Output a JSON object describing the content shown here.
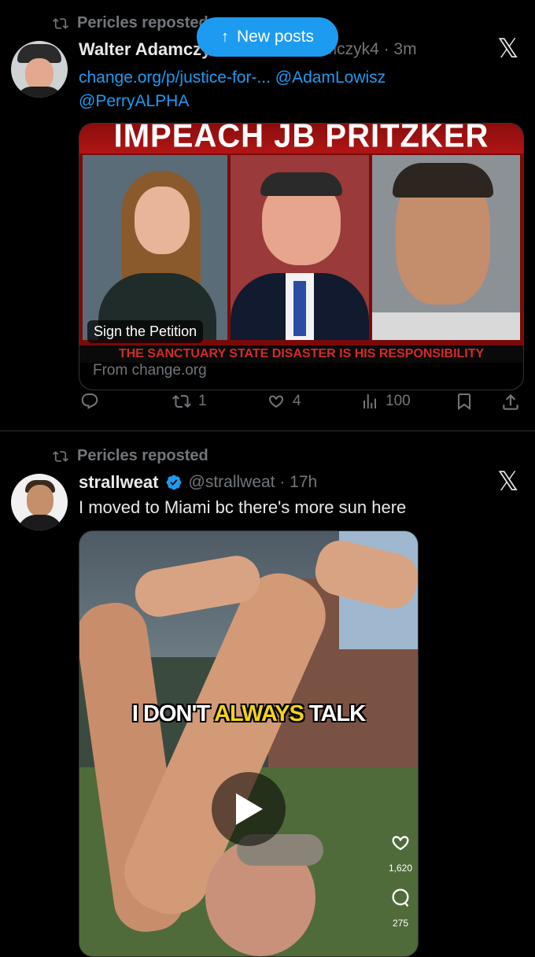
{
  "new_posts_pill": {
    "label": "New posts"
  },
  "posts": [
    {
      "repost_label": "Pericles reposted",
      "author_name": "Walter Adamczyk",
      "handle_time": "@WalterAdamczyk4 · 3m",
      "links_line1": "change.org/p/justice-for-... @AdamLowisz",
      "links_line2": "@PerryALPHA",
      "card": {
        "headline": "IMPEACH JB PRITZKER",
        "caption": "Sign the Petition",
        "banner": "THE SANCTUARY STATE DISASTER IS HIS RESPONSIBILITY",
        "source": "From change.org"
      },
      "actions": {
        "replies": "",
        "reposts": "1",
        "likes": "4",
        "views": "100"
      }
    },
    {
      "repost_label": "Pericles reposted",
      "author_name": "strallweat",
      "handle_time": "@strallweat · 17h",
      "text": "I moved to Miami bc there's more sun here",
      "video": {
        "caption_part1": "I DON'T ",
        "caption_part2": "ALWAYS",
        "caption_part3": " TALK",
        "likes": "1,620",
        "comments": "275"
      }
    }
  ],
  "colors": {
    "accent": "#1d9bf0",
    "muted": "#71767b",
    "background": "#000000"
  }
}
